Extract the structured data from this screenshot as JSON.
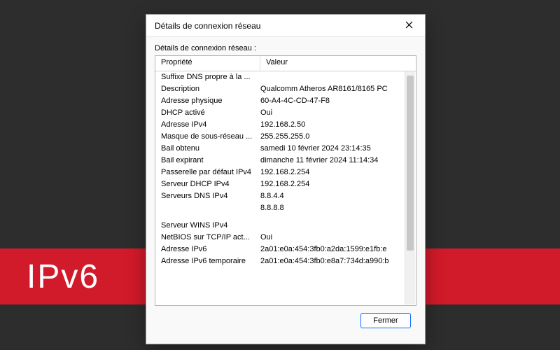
{
  "background": {
    "stripe_label": "IPv6"
  },
  "dialog": {
    "title": "Détails de connexion réseau",
    "subheading": "Détails de connexion réseau :",
    "columns": {
      "property": "Propriété",
      "value": "Valeur"
    },
    "rows": [
      {
        "property": "Suffixe DNS propre à la ...",
        "value": ""
      },
      {
        "property": "Description",
        "value": "Qualcomm Atheros AR8161/8165 PC"
      },
      {
        "property": "Adresse physique",
        "value": "60-A4-4C-CD-47-F8"
      },
      {
        "property": "DHCP activé",
        "value": "Oui"
      },
      {
        "property": "Adresse IPv4",
        "value": "192.168.2.50"
      },
      {
        "property": "Masque de sous-réseau ...",
        "value": "255.255.255.0"
      },
      {
        "property": "Bail obtenu",
        "value": "samedi 10 février 2024 23:14:35"
      },
      {
        "property": "Bail expirant",
        "value": "dimanche 11 février 2024 11:14:34"
      },
      {
        "property": "Passerelle par défaut IPv4",
        "value": "192.168.2.254"
      },
      {
        "property": "Serveur DHCP IPv4",
        "value": "192.168.2.254"
      },
      {
        "property": "Serveurs DNS IPv4",
        "value": "8.8.4.4"
      },
      {
        "property": "",
        "value": "8.8.8.8"
      },
      {
        "property": "Serveur WINS IPv4",
        "value": ""
      },
      {
        "property": "NetBIOS sur TCP/IP act...",
        "value": "Oui"
      },
      {
        "property": "Adresse IPv6",
        "value": "2a01:e0a:454:3fb0:a2da:1599:e1fb:e"
      },
      {
        "property": "Adresse IPv6 temporaire",
        "value": "2a01:e0a:454:3fb0:e8a7:734d:a990:b"
      }
    ],
    "close_button": "Fermer"
  }
}
